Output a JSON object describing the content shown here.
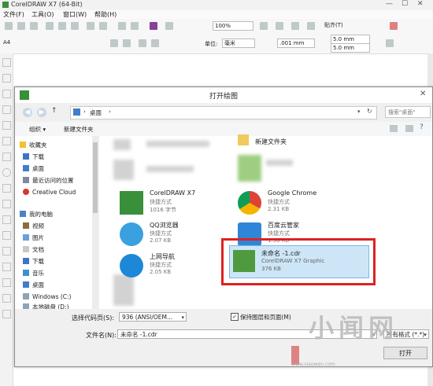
{
  "app": {
    "title": "CorelDRAW X7 (64-Bit)",
    "menu": [
      "文件(F)",
      "工具(O)",
      "窗口(W)",
      "帮助(H)"
    ],
    "zoom": "100%",
    "paper": "A4",
    "units_label": "单位:",
    "units_value": "毫米",
    "nudge": ".001 mm",
    "dup_x": "5.0 mm",
    "dup_y": "5.0 mm",
    "snap": "贴齐(T)"
  },
  "dialog": {
    "title": "打开绘图",
    "address": "桌面",
    "search_placeholder": "搜索\"桌面\"",
    "organize": "组织 ▾",
    "new_folder": "新建文件夹",
    "nav": {
      "favorites": "收藏夹",
      "downloads": "下载",
      "desktop": "桌面",
      "recent": "最近访问的位置",
      "creative_cloud": "Creative Cloud",
      "this_pc": "我的电脑",
      "videos": "视频",
      "pictures": "图片",
      "documents": "文档",
      "downloads2": "下载",
      "music": "音乐",
      "desktop2": "桌面",
      "drive_c": "Windows (C:)",
      "drive_d": "本地磁盘 (D:)"
    },
    "files": [
      {
        "name": "新建文件夹",
        "type": "",
        "size": ""
      },
      {
        "name": "CorelDRAW X7",
        "type": "快捷方式",
        "size": "1016 字节"
      },
      {
        "name": "Google Chrome",
        "type": "快捷方式",
        "size": "2.31 KB"
      },
      {
        "name": "QQ浏览器",
        "type": "快捷方式",
        "size": "2.07 KB"
      },
      {
        "name": "百度云管家",
        "type": "快捷方式",
        "size": "1.98 KB"
      },
      {
        "name": "上网导航",
        "type": "快捷方式",
        "size": "2.05 KB"
      },
      {
        "name": "未命名 -1.cdr",
        "type": "CorelDRAW X7 Graphic",
        "size": "376 KB"
      }
    ],
    "codepage_label": "选择代码页(S):",
    "codepage_value": "936  (ANSI/OEM...",
    "keep_layers": "保持图层和页面(M)",
    "filename_label": "文件名(N):",
    "filename_value": "未命名 -1.cdr",
    "filetype_value": "所有格式 (*.*)",
    "open_button": "打开"
  },
  "watermark": {
    "text": "小闻网",
    "site": "www.xiaowen.com"
  },
  "colors": {
    "selection": "#cde6f7",
    "highlight": "#d22222",
    "corel_green": "#3a8f3a"
  }
}
